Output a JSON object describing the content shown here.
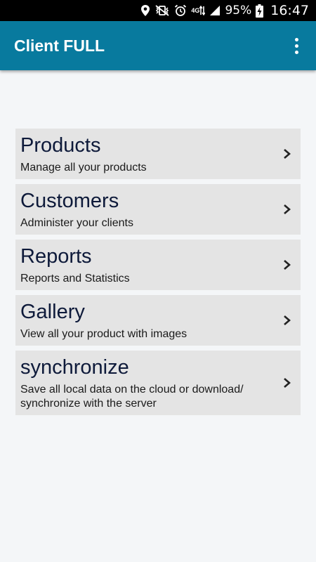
{
  "status_bar": {
    "battery": "95%",
    "time": "16:47",
    "network": "4G",
    "icons": [
      "location-icon",
      "vibrate-icon",
      "alarm-icon",
      "network-4g-icon",
      "signal-icon",
      "battery-charging-icon"
    ]
  },
  "app_bar": {
    "title": "Client FULL",
    "menu_icon": "overflow-menu-icon",
    "color": "#087a9e"
  },
  "menu": {
    "items": [
      {
        "title": "Products",
        "subtitle": "Manage all your products"
      },
      {
        "title": "Customers",
        "subtitle": "Administer your clients"
      },
      {
        "title": "Reports",
        "subtitle": "Reports and Statistics"
      },
      {
        "title": "Gallery",
        "subtitle": "View all your product with images"
      },
      {
        "title": "synchronize",
        "subtitle": "Save all local data on the cloud or download/ synchronize with the server"
      }
    ],
    "chevron_icon": "chevron-right-icon"
  }
}
